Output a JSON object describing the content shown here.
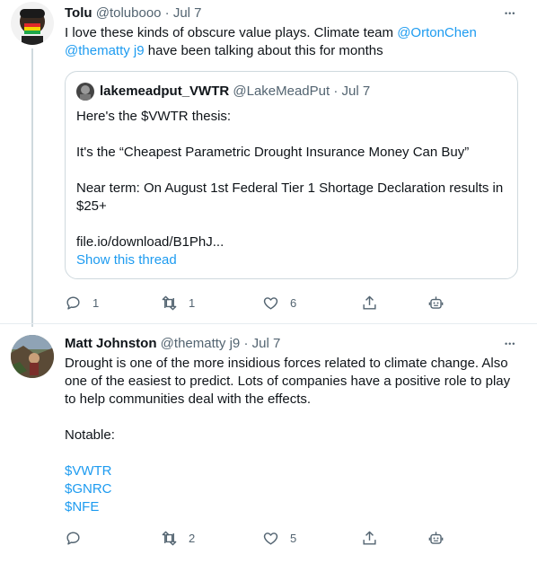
{
  "tweet1": {
    "name": "Tolu",
    "handle": "@tolubooo",
    "sep": "·",
    "date": "Jul 7",
    "more": "•••",
    "text_line1_a": "I love these kinds of obscure value plays. Climate team ",
    "mention1": "@OrtonChen",
    "mention2": "@thematty j9",
    "text_line2_b": " have been talking about this for months",
    "quote": {
      "name": "lakemeadput_VWTR",
      "handle": "@LakeMeadPut",
      "sep": "·",
      "date": "Jul 7",
      "line1": "Here's the $VWTR thesis:",
      "line2": "It's the “Cheapest Parametric Drought Insurance Money Can Buy”",
      "line3a": "Near term: On August 1st Federal Tier 1 Shortage Declaration results in",
      "line3b": "$25+",
      "line4": "file.io/download/B1PhJ...",
      "show_thread": "Show this thread"
    },
    "actions": {
      "reply": "1",
      "retweet": "1",
      "like": "6"
    }
  },
  "tweet2": {
    "name": "Matt Johnston",
    "handle": "@thematty j9",
    "sep": "·",
    "date": "Jul 7",
    "more": "•••",
    "line1": "Drought is one of the more insidious forces related to climate change. Also",
    "line2": "one of the easiest to predict. Lots of companies have a positive role to play",
    "line3": "to help communities deal with the effects.",
    "notable": "Notable:",
    "tickers": [
      "$VWTR",
      "$GNRC",
      "$NFE"
    ],
    "actions": {
      "reply": "",
      "retweet": "2",
      "like": "5"
    }
  },
  "colors": {
    "link": "#1d9bf0",
    "muted": "#536471",
    "border": "#cfd9de"
  },
  "icons": [
    "reply-icon",
    "retweet-icon",
    "like-icon",
    "share-icon",
    "bot-icon",
    "more-icon"
  ]
}
